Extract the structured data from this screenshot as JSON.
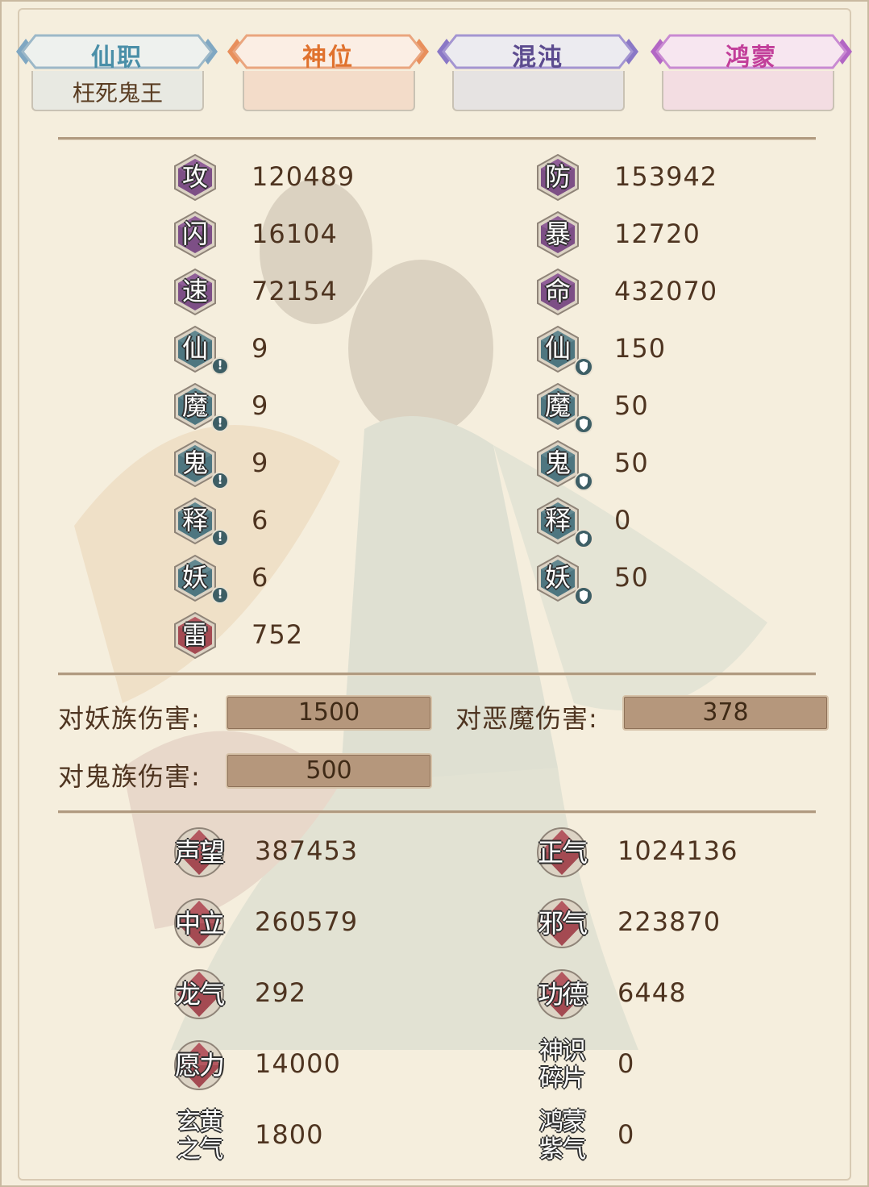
{
  "tabs": [
    {
      "label": "仙职",
      "color": "#4a8fa8",
      "sub": "枉死鬼王"
    },
    {
      "label": "神位",
      "color": "#e0722e",
      "sub": ""
    },
    {
      "label": "混沌",
      "color": "#5c4b8f",
      "sub": ""
    },
    {
      "label": "鸿蒙",
      "color": "#c23f9a",
      "sub": ""
    }
  ],
  "stats": {
    "attack": {
      "icon": "攻",
      "value": "120489"
    },
    "defense": {
      "icon": "防",
      "value": "153942"
    },
    "dodge": {
      "icon": "闪",
      "value": "16104"
    },
    "crit": {
      "icon": "暴",
      "value": "12720"
    },
    "speed": {
      "icon": "速",
      "value": "72154"
    },
    "hp": {
      "icon": "命",
      "value": "432070"
    },
    "xian_atk": {
      "icon": "仙",
      "value": "9"
    },
    "xian_def": {
      "icon": "仙",
      "value": "150"
    },
    "mo_atk": {
      "icon": "魔",
      "value": "9"
    },
    "mo_def": {
      "icon": "魔",
      "value": "50"
    },
    "gui_atk": {
      "icon": "鬼",
      "value": "9"
    },
    "gui_def": {
      "icon": "鬼",
      "value": "50"
    },
    "shi_atk": {
      "icon": "释",
      "value": "6"
    },
    "shi_def": {
      "icon": "释",
      "value": "0"
    },
    "yao_atk": {
      "icon": "妖",
      "value": "6"
    },
    "yao_def": {
      "icon": "妖",
      "value": "50"
    },
    "lei": {
      "icon": "雷",
      "value": "752"
    }
  },
  "badges": {
    "attack_mark": "!"
  },
  "damage": {
    "yao_label": "对妖族伤害:",
    "yao_value": "1500",
    "demon_label": "对恶魔伤害:",
    "demon_value": "378",
    "gui_label": "对鬼族伤害:",
    "gui_value": "500"
  },
  "resources": {
    "shengwang": {
      "icon": "声望",
      "value": "387453"
    },
    "zhengqi": {
      "icon": "正气",
      "value": "1024136"
    },
    "zhongli": {
      "icon": "中立",
      "value": "260579"
    },
    "xieqi": {
      "icon": "邪气",
      "value": "223870"
    },
    "longqi": {
      "icon": "龙气",
      "value": "292"
    },
    "gongde": {
      "icon": "功德",
      "value": "6448"
    },
    "yuanli": {
      "icon": "愿力",
      "value": "14000"
    },
    "shenshi_1": "神识",
    "shenshi_2": "碎片",
    "shenshi_value": "0",
    "xuanhuang_1": "玄黄",
    "xuanhuang_2": "之气",
    "xuanhuang_value": "1800",
    "hongmeng_1": "鸿蒙",
    "hongmeng_2": "紫气",
    "hongmeng_value": "0"
  },
  "colors": {
    "purple_hex": "#7d4f86",
    "teal_hex": "#4e7680",
    "red_hex": "#a44a52",
    "text": "#4e3420"
  }
}
